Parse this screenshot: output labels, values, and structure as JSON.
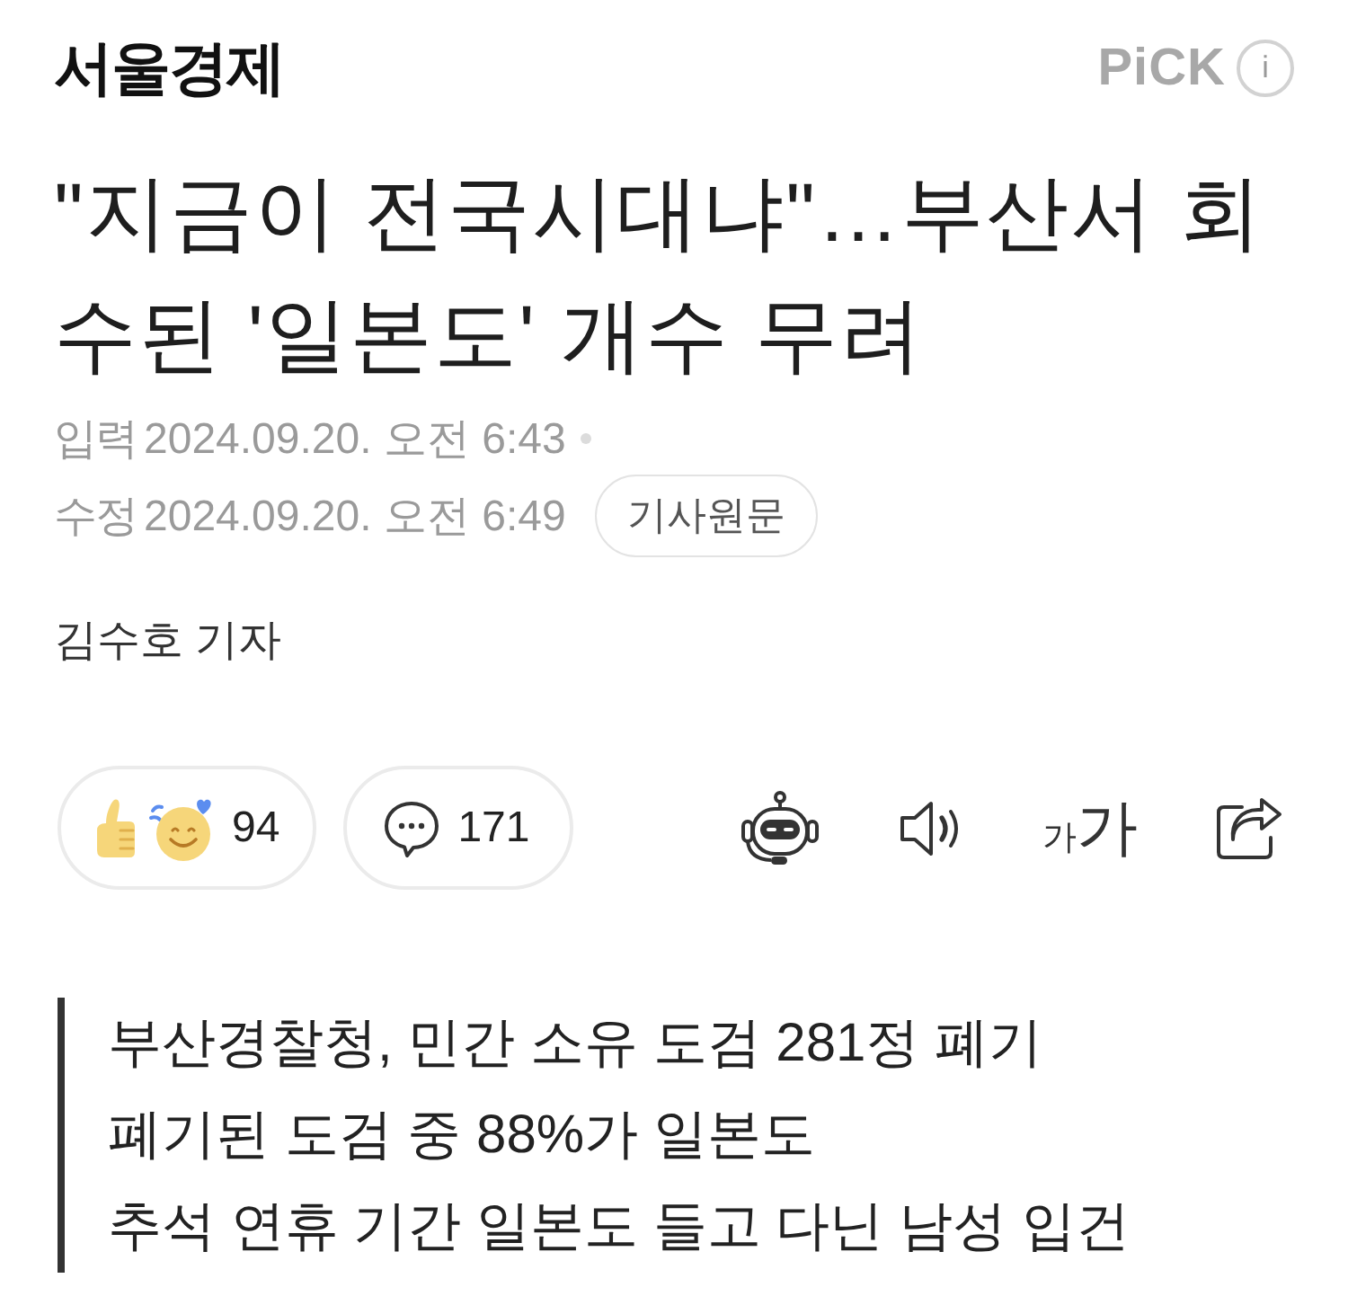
{
  "header": {
    "publisher": "서울경제",
    "pick_label": "PiCK",
    "info_button": "i"
  },
  "headline": "\"지금이 전국시대냐\"…부산서 회수된 '일본도' 개수 무려",
  "meta": {
    "published": {
      "label": "입력",
      "datetime": "2024.09.20. 오전 6:43"
    },
    "modified": {
      "label": "수정",
      "datetime": "2024.09.20. 오전 6:49"
    },
    "original_article_button": "기사원문"
  },
  "byline": "김수호 기자",
  "actions": {
    "reaction_count": "94",
    "comment_count": "171",
    "font_size_button": {
      "small": "가",
      "large": "가"
    }
  },
  "summary": [
    "부산경찰청, 민간 소유 도검 281정 폐기",
    "폐기된 도검 중 88%가 일본도",
    "추석 연휴 기간 일본도 들고 다닌 남성 입건"
  ]
}
